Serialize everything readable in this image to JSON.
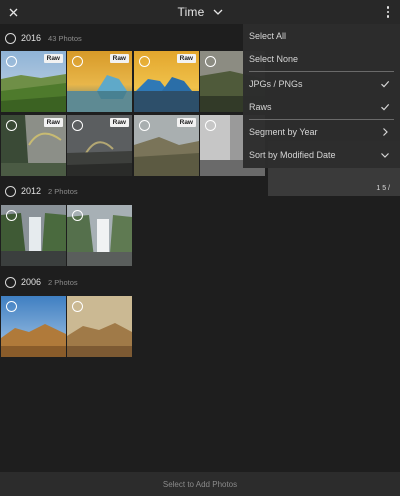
{
  "topbar": {
    "title": "Time"
  },
  "groups": [
    {
      "year": "2016",
      "count": "43 Photos"
    },
    {
      "year": "2012",
      "count": "2 Photos"
    },
    {
      "year": "2006",
      "count": "2 Photos"
    }
  ],
  "thumbs": {
    "raw_badge": "Raw"
  },
  "menu": {
    "items": [
      {
        "label": "Select All",
        "icon": ""
      },
      {
        "label": "Select None",
        "icon": ""
      },
      {
        "label": "JPGs / PNGs",
        "icon": "check-icon"
      },
      {
        "label": "Raws",
        "icon": "check-icon"
      },
      {
        "label": "Segment by Year",
        "icon": "chevron-right-icon"
      },
      {
        "label": "Sort by Modified Date",
        "icon": "chevron-down-icon"
      }
    ]
  },
  "peek_label": "1 5 /",
  "bottombar": {
    "label": "Select to Add Photos"
  },
  "colors": {
    "background": "#1e1e1e",
    "bar": "#282828",
    "menu": "#2c2c2c"
  }
}
